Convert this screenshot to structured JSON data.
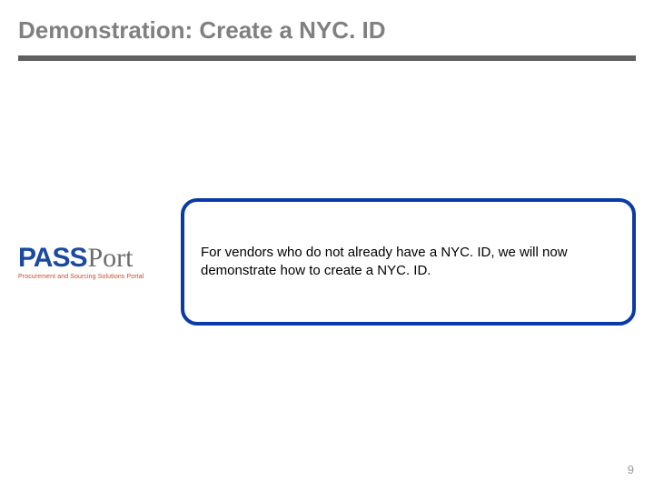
{
  "title": "Demonstration: Create a NYC. ID",
  "logo": {
    "pass": "PASS",
    "port": "Port",
    "tagline": "Procurement and Sourcing Solutions Portal"
  },
  "callout": {
    "body": "For vendors who do not already have a NYC. ID, we will now demonstrate how to create a NYC. ID."
  },
  "page_number": "9"
}
